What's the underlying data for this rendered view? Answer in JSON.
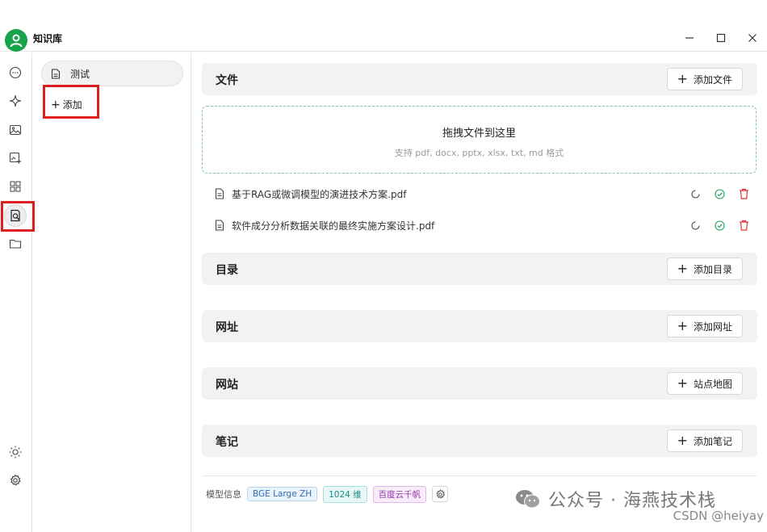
{
  "app": {
    "title": "知识库"
  },
  "colors": {
    "accent": "#16a34a",
    "highlight_box": "#e0201e",
    "dropzone_border": "#7fc8a0"
  },
  "rail": {
    "top_icons": [
      "chat-icon",
      "sparkle-icon",
      "image-icon",
      "image-edit-icon",
      "apps-grid-icon",
      "knowledge-base-icon",
      "folder-icon"
    ],
    "bottom_icons": [
      "sun-icon",
      "settings-icon"
    ],
    "active": "knowledge-base-icon"
  },
  "kb_panel": {
    "items": [
      {
        "label": "测试",
        "icon": "document-icon"
      }
    ],
    "add_label": "添加"
  },
  "sections": {
    "files": {
      "title": "文件",
      "button": "添加文件"
    },
    "dropzone": {
      "title": "拖拽文件到这里",
      "hint": "支持 pdf, docx, pptx, xlsx, txt, md 格式"
    },
    "file_list": [
      {
        "name": "基于RAG或微调模型的演进技术方案.pdf"
      },
      {
        "name": "软件成分分析数据关联的最终实施方案设计.pdf"
      }
    ],
    "directory": {
      "title": "目录",
      "button": "添加目录"
    },
    "url": {
      "title": "网址",
      "button": "添加网址"
    },
    "website": {
      "title": "网站",
      "button": "站点地图"
    },
    "notes": {
      "title": "笔记",
      "button": "添加笔记"
    }
  },
  "model_info": {
    "label": "模型信息",
    "model": "BGE Large ZH",
    "dimensions": "1024 维",
    "provider": "百度云千帆"
  },
  "watermark": {
    "text": "公众号 · 海燕技术栈",
    "csdn": "CSDN @heiyay"
  }
}
